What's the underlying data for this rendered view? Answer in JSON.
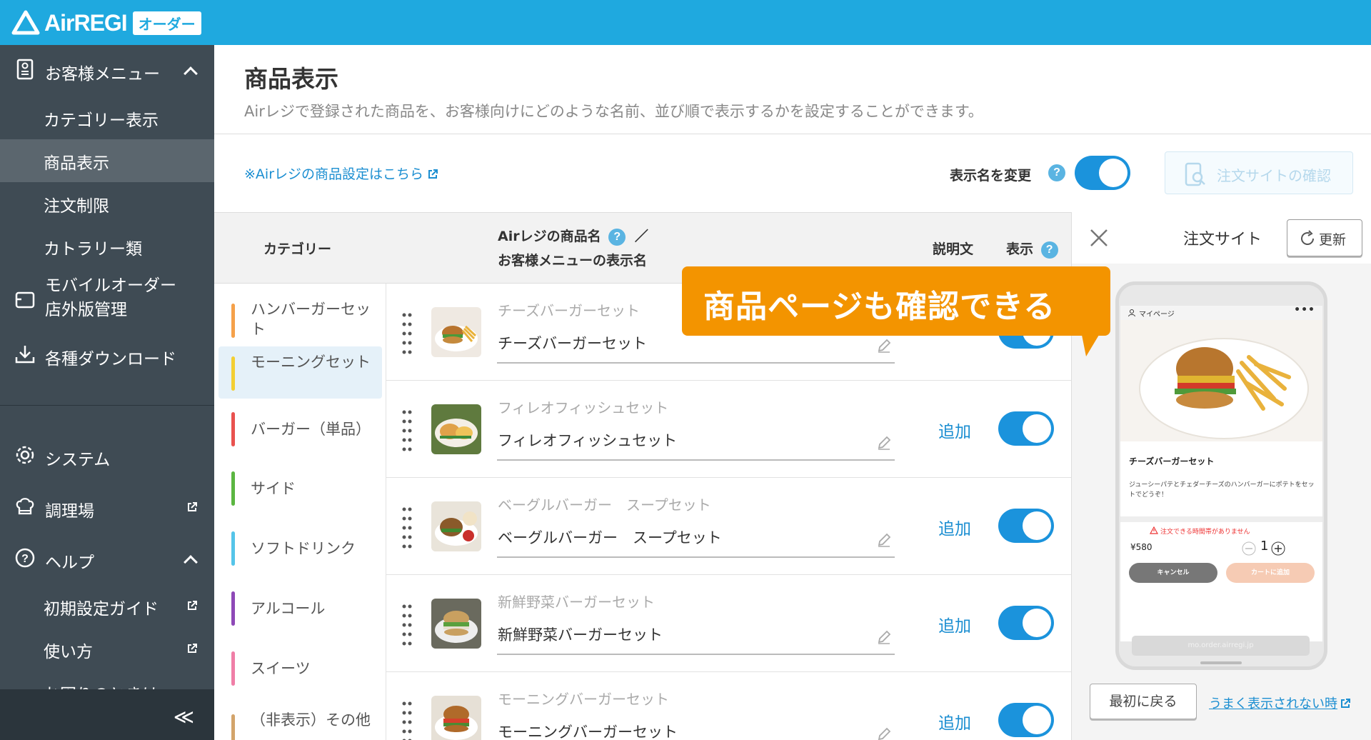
{
  "header": {
    "brand": "AirREGI",
    "badge": "オーダー"
  },
  "sidebar": {
    "guest_menu": "お客様メニュー",
    "items": [
      {
        "label": "カテゴリー表示"
      },
      {
        "label": "商品表示"
      },
      {
        "label": "注文制限"
      },
      {
        "label": "カトラリー類"
      }
    ],
    "mobile_order_line1": "モバイルオーダー",
    "mobile_order_line2": "店外版管理",
    "downloads": "各種ダウンロード",
    "system": "システム",
    "kitchen": "調理場",
    "help": "ヘルプ",
    "help_items": [
      {
        "label": "初期設定ガイド"
      },
      {
        "label": "使い方"
      },
      {
        "label": "お困りのときは"
      }
    ],
    "collapse": "≪"
  },
  "page": {
    "title": "商品表示",
    "description": "Airレジで登録された商品を、お客様向けにどのような名前、並び順で表示するかを設定することができます。",
    "airregi_link": "※Airレジの商品設定はこちら",
    "rename_label": "表示名を変更",
    "rename_enabled": true,
    "confirm_site": "注文サイトの確認"
  },
  "table": {
    "col_category": "カテゴリー",
    "col_product_line1": "Airレジの商品名",
    "col_product_slash": "／",
    "col_product_line2": "お客様メニューの表示名",
    "col_description": "説明文",
    "col_display": "表示",
    "categories": [
      {
        "label": "ハンバーガーセット",
        "color": "#f5a14a"
      },
      {
        "label": "モーニングセット",
        "color": "#f3cf34"
      },
      {
        "label": "バーガー（単品）",
        "color": "#e9524f"
      },
      {
        "label": "サイド",
        "color": "#5bb641"
      },
      {
        "label": "ソフトドリンク",
        "color": "#55c5e9"
      },
      {
        "label": "アルコール",
        "color": "#8e49b7"
      },
      {
        "label": "スイーツ",
        "color": "#f07fa7"
      },
      {
        "label": "（非表示）その他",
        "color": "#d3a46b"
      }
    ],
    "active_category": 1,
    "rows": [
      {
        "original": "チーズバーガーセット",
        "display": "チーズバーガーセット",
        "add": "",
        "visible": true
      },
      {
        "original": "フィレオフィッシュセット",
        "display": "フィレオフィッシュセット",
        "add": "追加",
        "visible": true
      },
      {
        "original": "ベーグルバーガー　スープセット",
        "display": "ベーグルバーガー　スープセット",
        "add": "追加",
        "visible": true
      },
      {
        "original": "新鮮野菜バーガーセット",
        "display": "新鮮野菜バーガーセット",
        "add": "追加",
        "visible": true
      },
      {
        "original": "モーニングバーガーセット",
        "display": "モーニングバーガーセット",
        "add": "追加",
        "visible": true
      }
    ]
  },
  "preview": {
    "title": "注文サイト",
    "refresh": "更新",
    "phone": {
      "mypage": "マイページ",
      "product_title": "チーズバーガーセット",
      "product_desc": "ジューシーパテとチェダーチーズのハンバーガーにポテトをセットでどうぞ！",
      "warning": "注文できる時間帯がありません",
      "price": "¥580",
      "qty": "1",
      "cancel": "キャンセル",
      "add_to_cart": "カートに追加",
      "url": "mo.order.airregi.jp"
    },
    "reset": "最初に戻る",
    "trouble": "うまく表示されない時"
  },
  "callout": {
    "text": "商品ページも確認できる"
  }
}
